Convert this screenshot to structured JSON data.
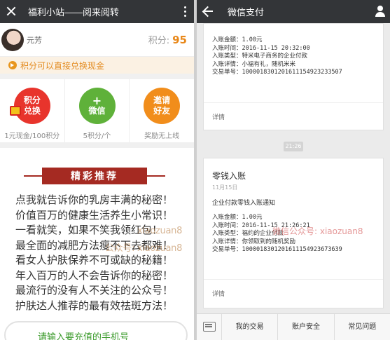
{
  "left": {
    "title": "福利小站——阅来阅转",
    "user": {
      "name": "元芳",
      "points_label": "积分:",
      "points": "95"
    },
    "notice": "积分可以直接兑换现金",
    "actions": [
      {
        "label_1": "积分",
        "label_2": "兑换",
        "sub": "1元现金/100积分",
        "color": "#e8342c"
      },
      {
        "label_1": "+",
        "label_2": "微信",
        "sub": "5积分/个",
        "color": "#5fb13a"
      },
      {
        "label_1": "邀请",
        "label_2": "好友",
        "sub": "奖励无上线",
        "color": "#f18d1b"
      }
    ],
    "banner": "精彩推荐",
    "lines": [
      "点我就告诉你的乳房丰满的秘密！",
      "价值百万的健康生活养生小常识！",
      "一看就笑，如果不笑我领红包！",
      "最全面的减肥方法瘦不下去都难！",
      "看女人护肤保养不可或缺的秘籍！",
      "年入百万的人不会告诉你的秘密！",
      "最流行的没有人不关注的公众号！",
      "护肤达人推荐的最有效祛斑方法！"
    ],
    "watermark_1": "xiaozuan8",
    "watermark_2": "公众号: xiaozuan8",
    "phone_placeholder": "请输入要充值的手机号"
  },
  "right": {
    "title": "微信支付",
    "card1": {
      "rows": [
        "入账金额：1.00元",
        "入账时间：2016-11-15 20:32:00",
        "入账类型：特米电子商务的企业付款",
        "入账详情：小福有礼，随机米米",
        "交易单号：1000018301201611154923233507"
      ],
      "detail": "详情"
    },
    "timestamp": "21:26",
    "card2": {
      "title": "零钱入账",
      "date": "11月15日",
      "subtitle": "企业付款零钱入账通知",
      "rows": [
        "入账金额：1.00元",
        "入账时间：2016-11-15 21:26:21",
        "入账类型：福约的企业付款",
        "入账详情：你领取到的随机奖励",
        "交易单号：1000018301201611154923673639"
      ],
      "detail": "详情"
    },
    "watermark": "微信公众号: xiaozuan8",
    "menu": [
      "我的交易",
      "账户安全",
      "常见问题"
    ]
  }
}
